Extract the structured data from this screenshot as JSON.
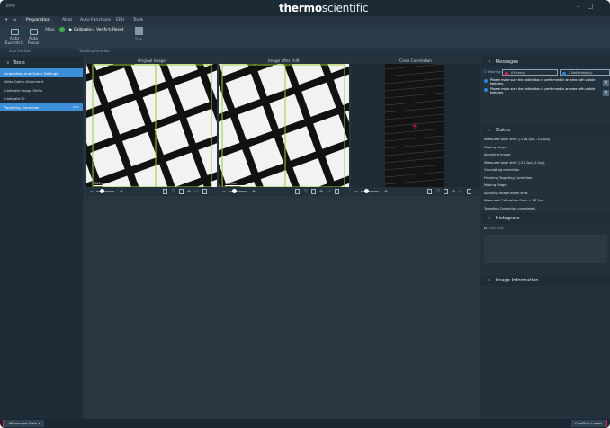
{
  "window": {
    "app_name": "EPU",
    "brand_bold": "thermo",
    "brand_light": "scientific",
    "minimize": "–",
    "maximize": "▢"
  },
  "ribbon": {
    "tabs": [
      "Preparation",
      "Atlas",
      "Auto Functions",
      "EPU",
      "Tools"
    ],
    "active_tab": "Preparation",
    "atlas_label": "Atlas",
    "calibrate": "Calibrate",
    "verify": "Verify",
    "reset": "Reset",
    "stop": "Stop",
    "auto_eucentric": "Auto Eucentric",
    "auto_focus": "Auto Focus",
    "sections": [
      "Auto Functions",
      "Targeting Correction"
    ]
  },
  "tools": {
    "title": "Tools",
    "items": [
      {
        "label": "Acquisition and Optics Settings",
        "badge": ""
      },
      {
        "label": "Atlas Optics Alignment",
        "badge": ""
      },
      {
        "label": "Calibrate Image Shifts",
        "badge": ""
      },
      {
        "label": "Calibrate IO",
        "badge": ""
      },
      {
        "label": "Targeting Correction",
        "badge": "Beta"
      }
    ],
    "selected_index": 4
  },
  "views": [
    {
      "title": "Original Image",
      "scale": "500 µm",
      "zoom": "1:1"
    },
    {
      "title": "Image after shift",
      "scale": "500 µm",
      "zoom": "1:1"
    },
    {
      "title": "Cross Correlation",
      "scale": "",
      "zoom": "1:1"
    }
  ],
  "messages": {
    "title": "Messages",
    "filtering_label": "Filtering:",
    "errors_filter": "0 Error(s)",
    "notifications_filter": "2 Notification(s)",
    "items": [
      "Please make sure the calibration is performed in an area with visible features.",
      "Please make sure the calibration is performed in an area with visible features."
    ]
  },
  "status": {
    "title": "Status",
    "lines": [
      "Measured pixel shift: [-116.3px, -33.8px]",
      "Moving stage.",
      "Acquiring image.",
      "Measured pixel shift: [-57.1px, 2.2px]",
      "Calculating correction.",
      "Finishing Targeting Correction.",
      "Moving Stage.",
      "Applying image beam shift.",
      "Measured Calibration Error = 98.2px",
      "Targeting Correction completed."
    ]
  },
  "histogram": {
    "title": "Histogram",
    "auto_filter": "Auto Filter"
  },
  "image_info": {
    "title": "Image Information"
  },
  "bottom": {
    "microscope_state": "Microscope State",
    "cryoflow": "CryoFlow Loader"
  },
  "colors": {
    "accent": "#3c8fd8",
    "error": "#e1224d",
    "frame": "#9acd32",
    "background": "#22313e"
  }
}
